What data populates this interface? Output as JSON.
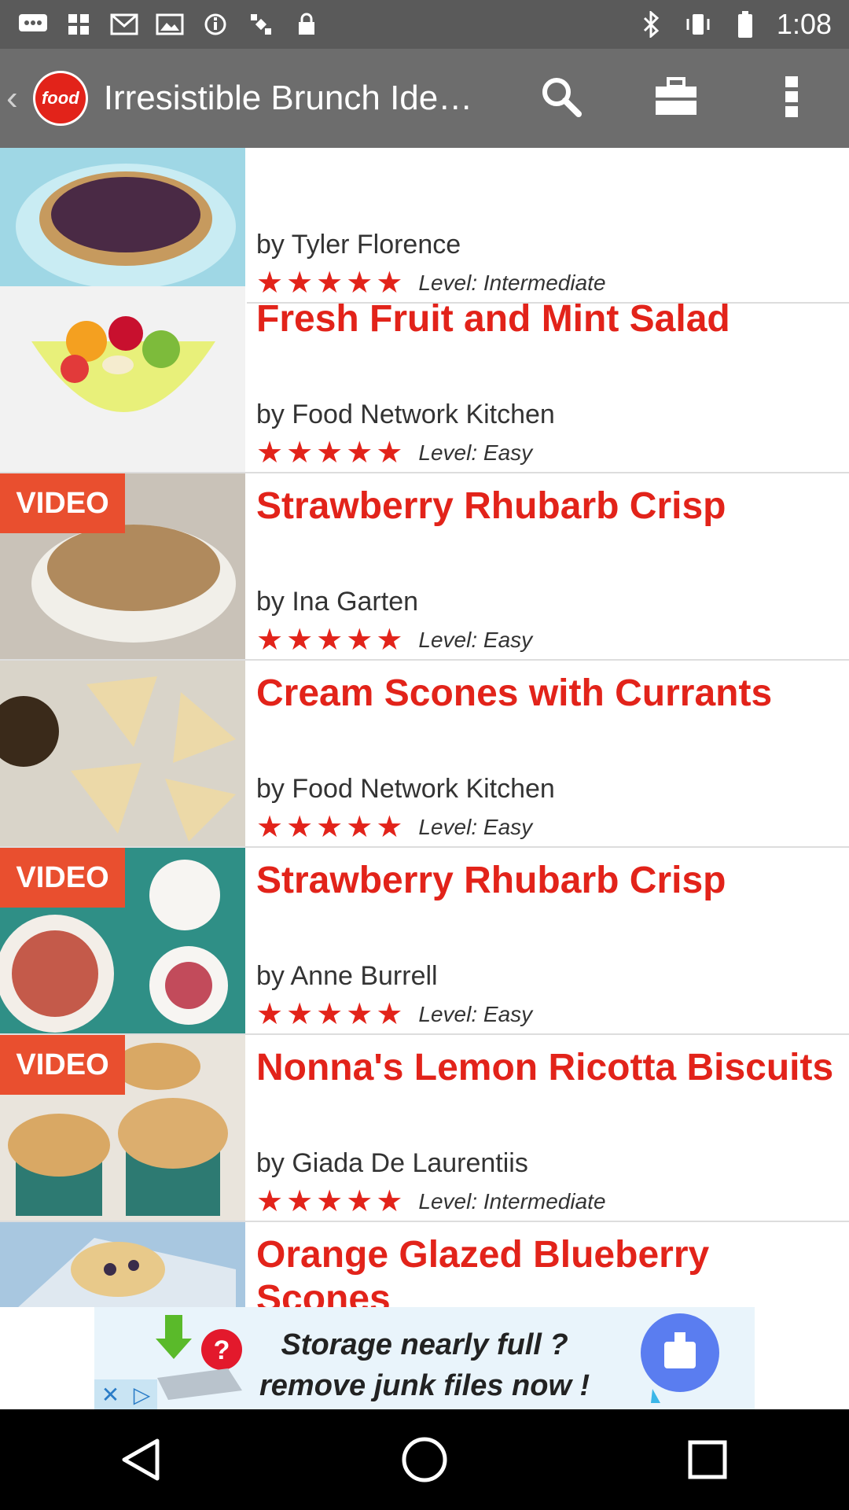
{
  "status_bar": {
    "time": "1:08",
    "icons_left": [
      "message-icon",
      "grid-icon",
      "mail-icon",
      "image-icon",
      "info-icon",
      "satellite-icon",
      "lock-icon"
    ],
    "icons_right": [
      "bluetooth-icon",
      "vibrate-icon",
      "battery-icon"
    ]
  },
  "appbar": {
    "title": "Irresistible Brunch Ide…",
    "logo_text": "food",
    "accent": "#e2231a"
  },
  "recipes": [
    {
      "title": "",
      "author": "by Tyler Florence",
      "level": "Level: Intermediate",
      "video": "",
      "rating": 5,
      "thumb_bg": "#9fd7e5"
    },
    {
      "title": "Fresh Fruit and Mint Salad",
      "author": "by Food Network Kitchen",
      "level": "Level: Easy",
      "video": "",
      "rating": 5,
      "thumb_bg": "#f2f2f2"
    },
    {
      "title": "Strawberry Rhubarb Crisp",
      "author": "by Ina Garten",
      "level": "Level: Easy",
      "video": "VIDEO",
      "rating": 5,
      "thumb_bg": "#c9c2b8"
    },
    {
      "title": "Cream Scones with Currants",
      "author": "by Food Network Kitchen",
      "level": "Level: Easy",
      "video": "",
      "rating": 5,
      "thumb_bg": "#d9d4c9"
    },
    {
      "title": "Strawberry Rhubarb Crisp",
      "author": "by Anne Burrell",
      "level": "Level: Easy",
      "video": "VIDEO",
      "rating": 5,
      "thumb_bg": "#2f8f86"
    },
    {
      "title": "Nonna's Lemon Ricotta Biscuits",
      "author": "by Giada De Laurentiis",
      "level": "Level: Intermediate",
      "video": "VIDEO",
      "rating": 5,
      "thumb_bg": "#e9e4dc"
    },
    {
      "title": "Orange Glazed Blueberry Scones",
      "author": "",
      "level": "",
      "video": "",
      "rating": 0,
      "thumb_bg": "#a8c7e0"
    }
  ],
  "ad": {
    "line1": "Storage nearly full ?",
    "line2": "remove junk files now !",
    "close_symbol": "✕",
    "play_symbol": "▷"
  },
  "nav": [
    "back-icon",
    "home-icon",
    "recents-icon"
  ]
}
